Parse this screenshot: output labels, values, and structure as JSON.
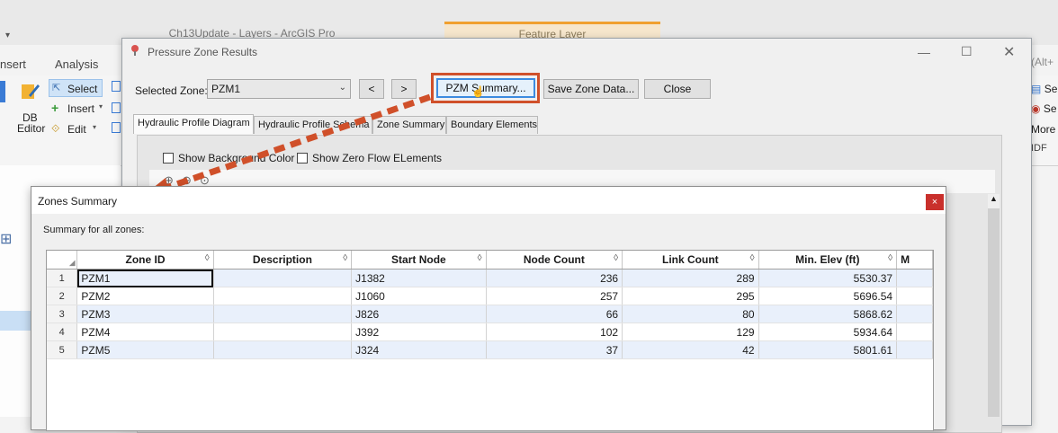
{
  "arcgis": {
    "title": "Ch13Update - Layers - ArcGIS Pro",
    "feature_layer_tab": "Feature Layer",
    "tabs": [
      "nsert",
      "Analysis"
    ],
    "ribbon": {
      "select": "Select",
      "insert": "Insert",
      "edit": "Edit",
      "db_editor_1": "DB",
      "db_editor_2": "Editor"
    },
    "right_fragments": [
      "(Alt+",
      "Se",
      "Se",
      "More",
      "IDF"
    ]
  },
  "pzr": {
    "title": "Pressure Zone Results",
    "selected_zone_label": "Selected Zone:",
    "selected_zone_value": "PZM1",
    "prev_label": "<",
    "next_label": ">",
    "pzm_summary_label": "PZM Summary...",
    "save_zone_data_label": "Save Zone Data...",
    "close_label": "Close",
    "tabs": [
      "Hydraulic Profile Diagram",
      "Hydraulic Profile Schema",
      "Zone Summary",
      "Boundary Elements"
    ],
    "show_background_color": "Show Background Color",
    "show_zero_flow": "Show Zero Flow ELements"
  },
  "zones_summary": {
    "title": "Zones Summary",
    "caption": "Summary for all zones:",
    "close_label": "×",
    "columns": [
      "Zone ID",
      "Description",
      "Start Node",
      "Node Count",
      "Link Count",
      "Min. Elev (ft)",
      "M"
    ],
    "rows": [
      {
        "num": "1",
        "zone_id": "PZM1",
        "description": "",
        "start_node": "J1382",
        "node_count": "236",
        "link_count": "289",
        "min_elev": "5530.37"
      },
      {
        "num": "2",
        "zone_id": "PZM2",
        "description": "",
        "start_node": "J1060",
        "node_count": "257",
        "link_count": "295",
        "min_elev": "5696.54"
      },
      {
        "num": "3",
        "zone_id": "PZM3",
        "description": "",
        "start_node": "J826",
        "node_count": "66",
        "link_count": "80",
        "min_elev": "5868.62"
      },
      {
        "num": "4",
        "zone_id": "PZM4",
        "description": "",
        "start_node": "J392",
        "node_count": "102",
        "link_count": "129",
        "min_elev": "5934.64"
      },
      {
        "num": "5",
        "zone_id": "PZM5",
        "description": "",
        "start_node": "J324",
        "node_count": "37",
        "link_count": "42",
        "min_elev": "5801.61"
      }
    ]
  },
  "colors": {
    "highlight": "#d0502a",
    "row_alt": "#e9f0fb"
  }
}
